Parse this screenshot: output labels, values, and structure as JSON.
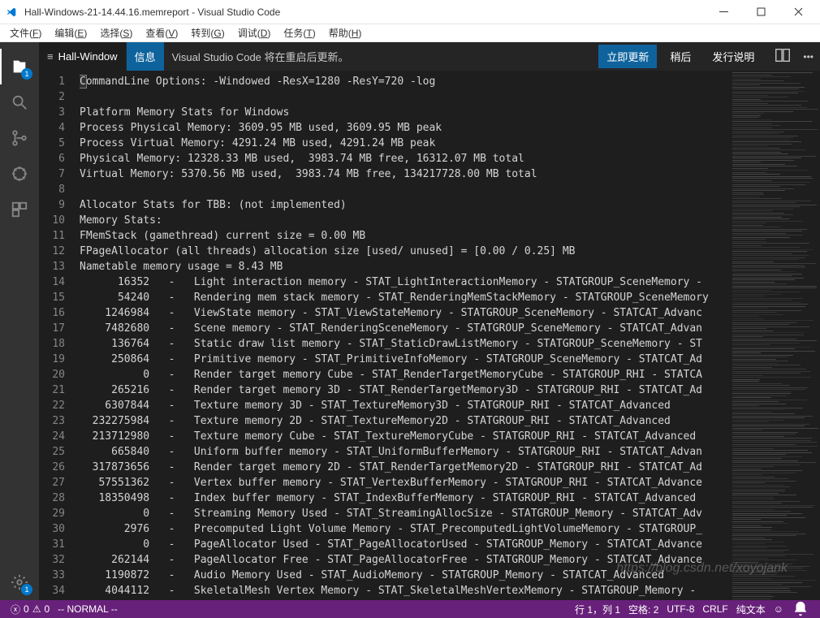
{
  "window": {
    "title": "Hall-Windows-21-14.44.16.memreport - Visual Studio Code"
  },
  "menu": {
    "items": [
      {
        "label": "文件",
        "key": "F"
      },
      {
        "label": "编辑",
        "key": "E"
      },
      {
        "label": "选择",
        "key": "S"
      },
      {
        "label": "查看",
        "key": "V"
      },
      {
        "label": "转到",
        "key": "G"
      },
      {
        "label": "调试",
        "key": "D"
      },
      {
        "label": "任务",
        "key": "T"
      },
      {
        "label": "帮助",
        "key": "H"
      }
    ]
  },
  "activitybar": {
    "explorer_badge": "1",
    "settings_badge": "1"
  },
  "tab": {
    "filename": "Hall-Window"
  },
  "notification": {
    "badge": "信息",
    "text": "Visual Studio Code 将在重启后更新。",
    "update_now": "立即更新",
    "later": "稍后",
    "release_notes": "发行说明"
  },
  "editor": {
    "lines": [
      "CommandLine Options: -Windowed -ResX=1280 -ResY=720 -log",
      "",
      "Platform Memory Stats for Windows",
      "Process Physical Memory: 3609.95 MB used, 3609.95 MB peak",
      "Process Virtual Memory: 4291.24 MB used, 4291.24 MB peak",
      "Physical Memory: 12328.33 MB used,  3983.74 MB free, 16312.07 MB total",
      "Virtual Memory: 5370.56 MB used,  3983.74 MB free, 134217728.00 MB total",
      "",
      "Allocator Stats for TBB: (not implemented)",
      "Memory Stats:",
      "FMemStack (gamethread) current size = 0.00 MB",
      "FPageAllocator (all threads) allocation size [used/ unused] = [0.00 / 0.25] MB",
      "Nametable memory usage = 8.43 MB",
      "      16352   -   Light interaction memory - STAT_LightInteractionMemory - STATGROUP_SceneMemory -",
      "      54240   -   Rendering mem stack memory - STAT_RenderingMemStackMemory - STATGROUP_SceneMemory",
      "    1246984   -   ViewState memory - STAT_ViewStateMemory - STATGROUP_SceneMemory - STATCAT_Advanc",
      "    7482680   -   Scene memory - STAT_RenderingSceneMemory - STATGROUP_SceneMemory - STATCAT_Advan",
      "     136764   -   Static draw list memory - STAT_StaticDrawListMemory - STATGROUP_SceneMemory - ST",
      "     250864   -   Primitive memory - STAT_PrimitiveInfoMemory - STATGROUP_SceneMemory - STATCAT_Ad",
      "          0   -   Render target memory Cube - STAT_RenderTargetMemoryCube - STATGROUP_RHI - STATCA",
      "     265216   -   Render target memory 3D - STAT_RenderTargetMemory3D - STATGROUP_RHI - STATCAT_Ad",
      "    6307844   -   Texture memory 3D - STAT_TextureMemory3D - STATGROUP_RHI - STATCAT_Advanced",
      "  232275984   -   Texture memory 2D - STAT_TextureMemory2D - STATGROUP_RHI - STATCAT_Advanced",
      "  213712980   -   Texture memory Cube - STAT_TextureMemoryCube - STATGROUP_RHI - STATCAT_Advanced",
      "     665840   -   Uniform buffer memory - STAT_UniformBufferMemory - STATGROUP_RHI - STATCAT_Advan",
      "  317873656   -   Render target memory 2D - STAT_RenderTargetMemory2D - STATGROUP_RHI - STATCAT_Ad",
      "   57551362   -   Vertex buffer memory - STAT_VertexBufferMemory - STATGROUP_RHI - STATCAT_Advance",
      "   18350498   -   Index buffer memory - STAT_IndexBufferMemory - STATGROUP_RHI - STATCAT_Advanced",
      "          0   -   Streaming Memory Used - STAT_StreamingAllocSize - STATGROUP_Memory - STATCAT_Adv",
      "       2976   -   Precomputed Light Volume Memory - STAT_PrecomputedLightVolumeMemory - STATGROUP_",
      "          0   -   PageAllocator Used - STAT_PageAllocatorUsed - STATGROUP_Memory - STATCAT_Advance",
      "     262144   -   PageAllocator Free - STAT_PageAllocatorFree - STATGROUP_Memory - STATCAT_Advance",
      "    1190872   -   Audio Memory Used - STAT_AudioMemory - STATGROUP_Memory - STATCAT_Advanced",
      "    4044112   -   SkeletalMesh Vertex Memory - STAT_SkeletalMeshVertexMemory - STATGROUP_Memory - "
    ]
  },
  "statusbar": {
    "errors": "0",
    "warnings": "0",
    "mode": "-- NORMAL --",
    "position": "行 1，列 1",
    "spaces": "空格: 2",
    "encoding": "UTF-8",
    "eol": "CRLF",
    "language": "纯文本",
    "feedback_icon": "☺"
  },
  "watermark": "https://blog.csdn.net/xoyojank"
}
